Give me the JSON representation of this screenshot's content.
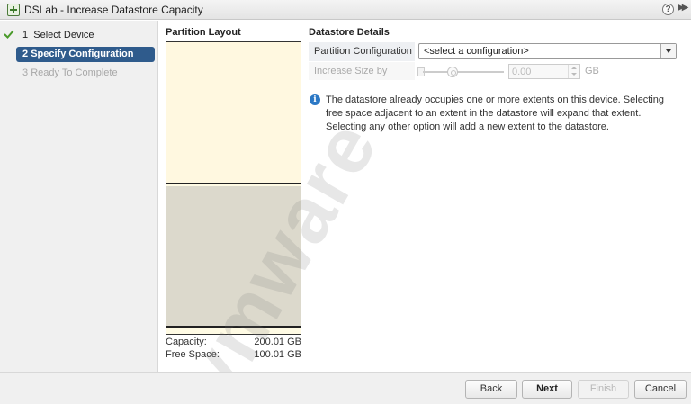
{
  "window": {
    "title": "DSLab - Increase Datastore Capacity",
    "help_icon": "help-icon",
    "help_glyph": "?",
    "expand_icon": "double-chevron-right-icon",
    "expand_glyph": "▶▶"
  },
  "steps": [
    {
      "number": "1",
      "label": "Select Device",
      "state": "completed",
      "icon": "check-icon"
    },
    {
      "number": "2",
      "label": "Specify Configuration",
      "state": "active"
    },
    {
      "number": "3",
      "label": "Ready To Complete",
      "state": "disabled"
    }
  ],
  "partition_layout": {
    "title": "Partition Layout",
    "capacity_label": "Capacity:",
    "capacity_value": "200.01 GB",
    "free_space_label": "Free Space:",
    "free_space_value": "100.01 GB"
  },
  "details": {
    "title": "Datastore Details",
    "partition_config_label": "Partition Configuration",
    "partition_config_value": "<select a configuration>",
    "increase_size_label": "Increase Size by",
    "increase_size_value": "0.00",
    "increase_size_unit": "GB",
    "info_glyph": "i",
    "info_text": "The datastore already occupies one or more extents on this device. Selecting free space adjacent to an extent in the datastore will expand that extent. Selecting any other option will add a new extent to the datastore."
  },
  "watermark": "vmware",
  "buttons": {
    "back": "Back",
    "next": "Next",
    "finish": "Finish",
    "cancel": "Cancel"
  },
  "colors": {
    "active_step": "#2f5b8c",
    "info_icon": "#2b78c5",
    "check": "#4a9a2a"
  }
}
